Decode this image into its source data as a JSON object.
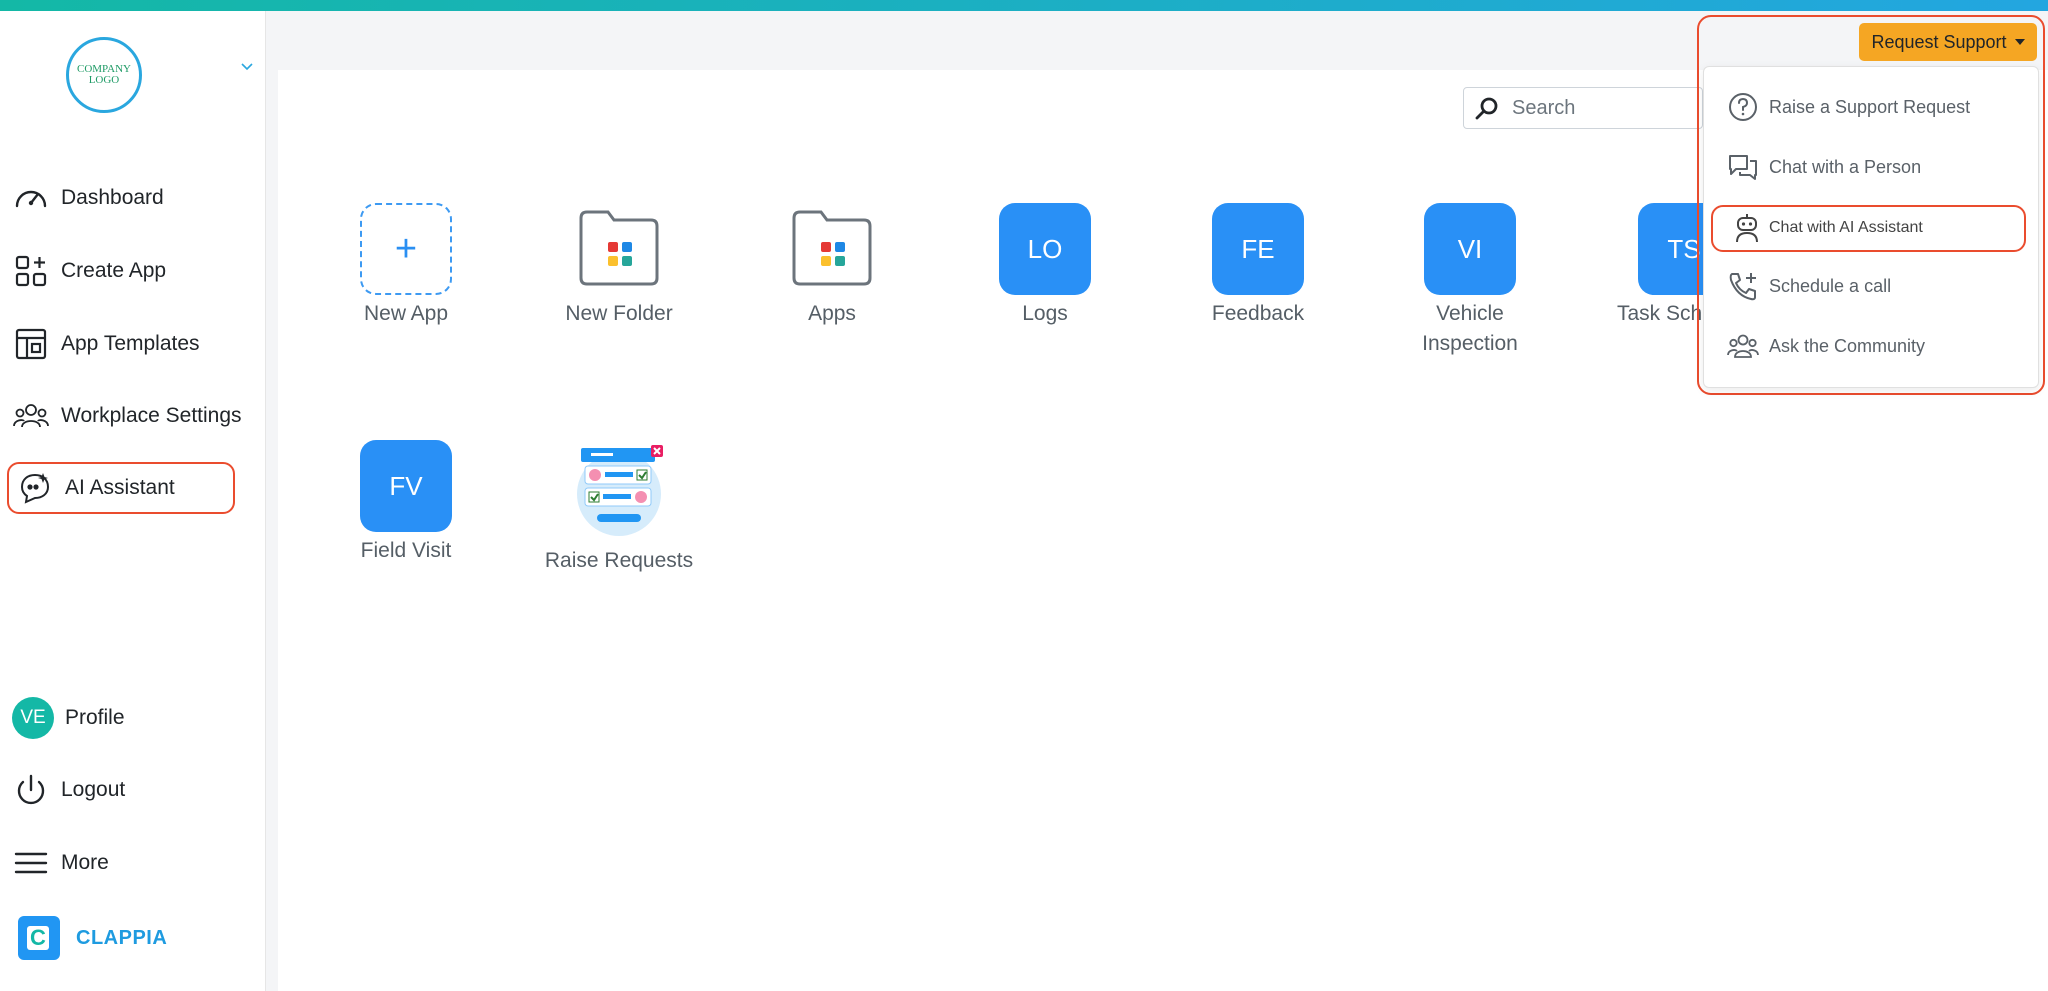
{
  "logo": {
    "text_line1": "COMPANY",
    "text_line2": "LOGO"
  },
  "sidebar": {
    "items": [
      {
        "label": "Dashboard",
        "icon": "gauge-icon"
      },
      {
        "label": "Create App",
        "icon": "create-app-icon"
      },
      {
        "label": "App Templates",
        "icon": "templates-icon"
      },
      {
        "label": "Workplace Settings",
        "icon": "users-icon"
      },
      {
        "label": "AI Assistant",
        "icon": "ai-chat-icon",
        "active": true
      }
    ],
    "profile": {
      "initials": "VE",
      "label": "Profile"
    },
    "logout": {
      "label": "Logout"
    },
    "more": {
      "label": "More"
    },
    "brand": {
      "mark": "C",
      "name": "CLAPPIA"
    }
  },
  "search": {
    "placeholder": "Search"
  },
  "apps": [
    {
      "label": "New App",
      "kind": "new",
      "glyph": "+"
    },
    {
      "label": "New Folder",
      "kind": "folder"
    },
    {
      "label": "Apps",
      "kind": "folder"
    },
    {
      "label": "Logs",
      "kind": "app",
      "initials": "LO"
    },
    {
      "label": "Feedback",
      "kind": "app",
      "initials": "FE"
    },
    {
      "label": "Vehicle Inspection",
      "kind": "app",
      "initials": "VI"
    },
    {
      "label": "Task Sch",
      "kind": "app",
      "initials": "TS"
    },
    {
      "label": "Field Visit",
      "kind": "app",
      "initials": "FV"
    },
    {
      "label": "Raise Requests",
      "kind": "illustration"
    }
  ],
  "support": {
    "button_label": "Request Support",
    "menu": [
      {
        "label": "Raise a Support Request",
        "icon": "question-circle-icon"
      },
      {
        "label": "Chat with a Person",
        "icon": "chat-bubbles-icon"
      },
      {
        "label": "Chat with AI Assistant",
        "icon": "robot-icon",
        "highlighted": true
      },
      {
        "label": "Schedule a call",
        "icon": "phone-plus-icon"
      },
      {
        "label": "Ask the Community",
        "icon": "community-icon"
      }
    ]
  },
  "colors": {
    "accent": "#2990f6",
    "support_button": "#f5a623",
    "highlight_border": "#ea4c2e",
    "avatar": "#14b8a6",
    "brand": "#1e9be0"
  }
}
